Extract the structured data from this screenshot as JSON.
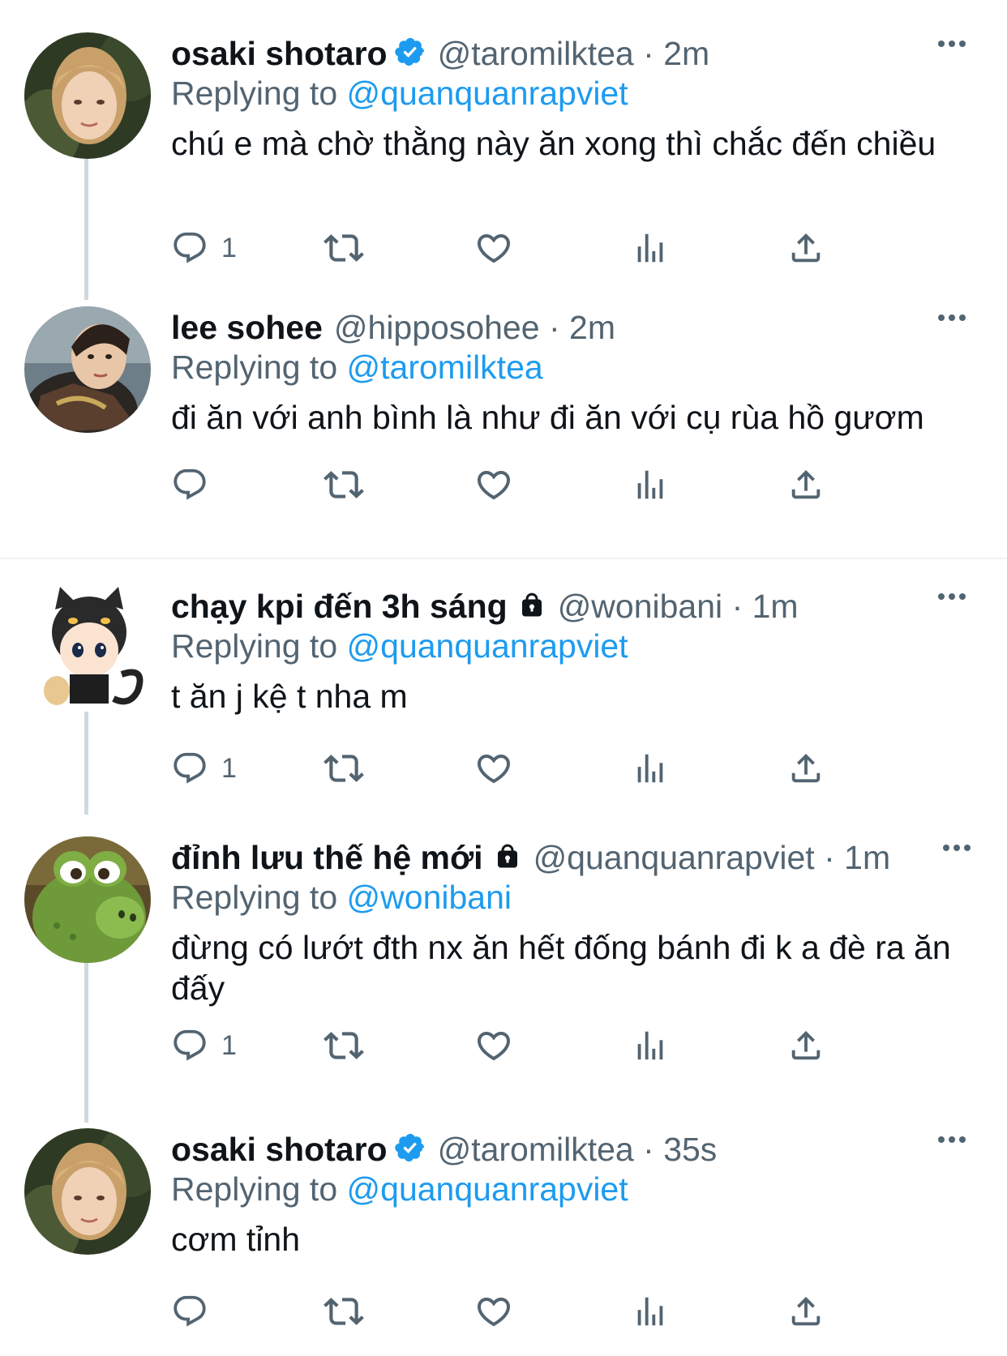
{
  "tweets": [
    {
      "name": "osaki shotaro",
      "verified": true,
      "handle": "@taromilktea",
      "time": "2m",
      "replying_label": "Replying to",
      "replying_to": "@quanquanrapviet",
      "text": "chú e mà chờ thằng này ăn xong thì chắc đến chiều",
      "reply_count": "1",
      "avatar": "portrait-blond"
    },
    {
      "name": "lee sohee",
      "verified": false,
      "handle": "@hipposohee",
      "time": "2m",
      "replying_label": "Replying to",
      "replying_to": "@taromilktea",
      "text": "đi ăn với anh bình là như đi ăn với cụ rùa hồ gươm",
      "reply_count": "",
      "avatar": "portrait-dark"
    },
    {
      "name": "chạy kpi đến 3h sáng",
      "locked": true,
      "handle": "@wonibani",
      "time": "1m",
      "replying_label": "Replying to",
      "replying_to": "@quanquanrapviet",
      "text": "t ăn j kệ t nha m",
      "reply_count": "1",
      "avatar": "doll-cat-hood"
    },
    {
      "name": "đỉnh lưu thế hệ mới",
      "locked": true,
      "handle": "@quanquanrapviet",
      "time": "1m",
      "replying_label": "Replying to",
      "replying_to": "@wonibani",
      "text": "đừng có lướt đth nx ăn hết đống bánh đi k a đè ra ăn đấy",
      "reply_count": "1",
      "avatar": "green-dinosaur"
    },
    {
      "name": "osaki shotaro",
      "verified": true,
      "handle": "@taromilktea",
      "time": "35s",
      "replying_label": "Replying to",
      "replying_to": "@quanquanrapviet",
      "text": "cơm tỉnh",
      "reply_count": "",
      "avatar": "portrait-blond"
    }
  ],
  "separator": "·",
  "icons": {
    "reply": "reply-icon",
    "retweet": "retweet-icon",
    "like": "heart-icon",
    "views": "views-icon",
    "share": "share-icon",
    "verified": "verified-badge-icon",
    "lock": "lock-icon",
    "more": "more-icon"
  },
  "colors": {
    "link": "#1d9bf0",
    "secondary": "#536471",
    "text": "#0f1419",
    "thread_line": "#cfd9de"
  }
}
